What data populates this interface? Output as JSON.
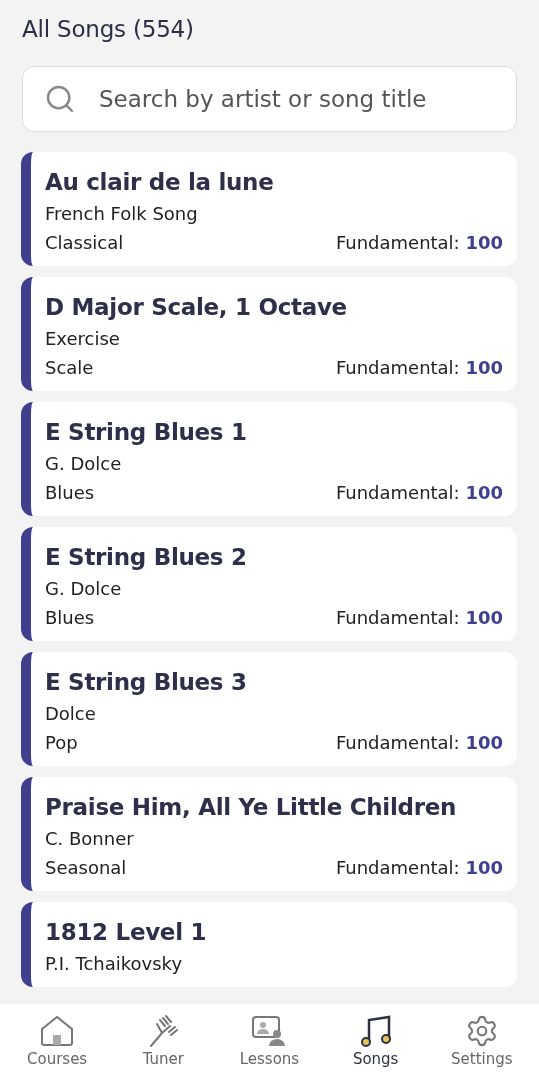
{
  "header": {
    "title": "All Songs (554)"
  },
  "search": {
    "placeholder": "Search by artist or song title"
  },
  "songs": [
    {
      "title": "Au clair de la lune",
      "artist": "French Folk Song",
      "genre": "Classical",
      "level_label": "Fundamental:",
      "score": "100"
    },
    {
      "title": "D Major Scale, 1 Octave",
      "artist": "Exercise",
      "genre": "Scale",
      "level_label": "Fundamental:",
      "score": "100"
    },
    {
      "title": "E String Blues 1",
      "artist": "G. Dolce",
      "genre": "Blues",
      "level_label": "Fundamental:",
      "score": "100"
    },
    {
      "title": "E String Blues 2",
      "artist": "G. Dolce",
      "genre": "Blues",
      "level_label": "Fundamental:",
      "score": "100"
    },
    {
      "title": "E String Blues 3",
      "artist": "Dolce",
      "genre": "Pop",
      "level_label": "Fundamental:",
      "score": "100"
    },
    {
      "title": "Praise Him, All Ye Little Children",
      "artist": "C. Bonner",
      "genre": "Seasonal",
      "level_label": "Fundamental:",
      "score": "100"
    },
    {
      "title": "1812 Level 1",
      "artist": "P.I. Tchaikovsky"
    }
  ],
  "nav": [
    {
      "kind": "courses",
      "label": "Courses",
      "selected": false
    },
    {
      "kind": "tuner",
      "label": "Tuner",
      "selected": false
    },
    {
      "kind": "lessons",
      "label": "Lessons",
      "selected": false
    },
    {
      "kind": "songs",
      "label": "Songs",
      "selected": true
    },
    {
      "kind": "settings",
      "label": "Settings",
      "selected": false
    }
  ]
}
